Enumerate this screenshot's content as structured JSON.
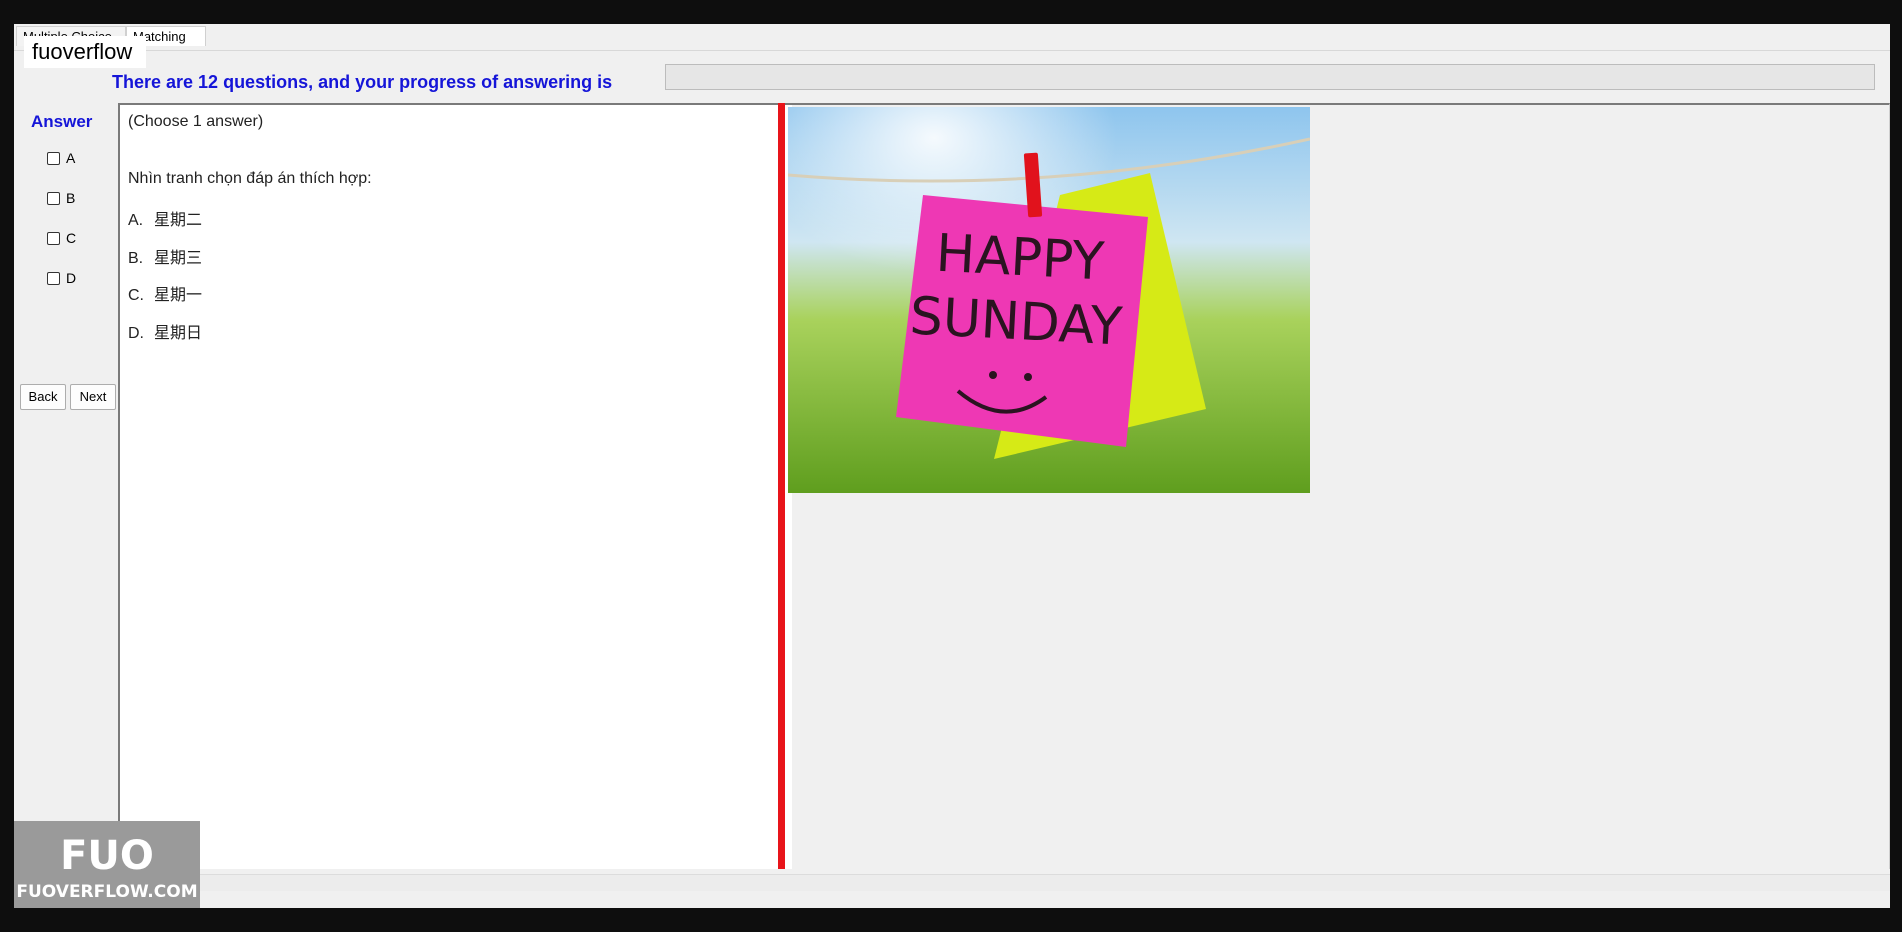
{
  "overlay_label": "fuoverflow",
  "tabs": [
    {
      "label": "Multiple Choice"
    },
    {
      "label": "Matching"
    }
  ],
  "progress": {
    "text": "There are 12 questions, and your progress of answering is",
    "fraction": 0
  },
  "answer_panel": {
    "title": "Answer",
    "options": [
      "A",
      "B",
      "C",
      "D"
    ],
    "back_label": "Back",
    "next_label": "Next"
  },
  "question": {
    "instruction": "(Choose 1 answer)",
    "prompt": "Nhìn tranh chọn đáp án thích hợp:",
    "options": [
      {
        "letter": "A.",
        "text": "星期二"
      },
      {
        "letter": "B.",
        "text": "星期三"
      },
      {
        "letter": "C.",
        "text": "星期一"
      },
      {
        "letter": "D.",
        "text": "星期日"
      }
    ]
  },
  "picture": {
    "line1": "HAPPY",
    "line2": "SUNDAY"
  },
  "watermark": {
    "logo": "FUO",
    "site": "FUOVERFLOW.COM"
  },
  "colors": {
    "accent_text": "#1515d8",
    "divider": "#e8141a",
    "note": "#ee38b4"
  }
}
